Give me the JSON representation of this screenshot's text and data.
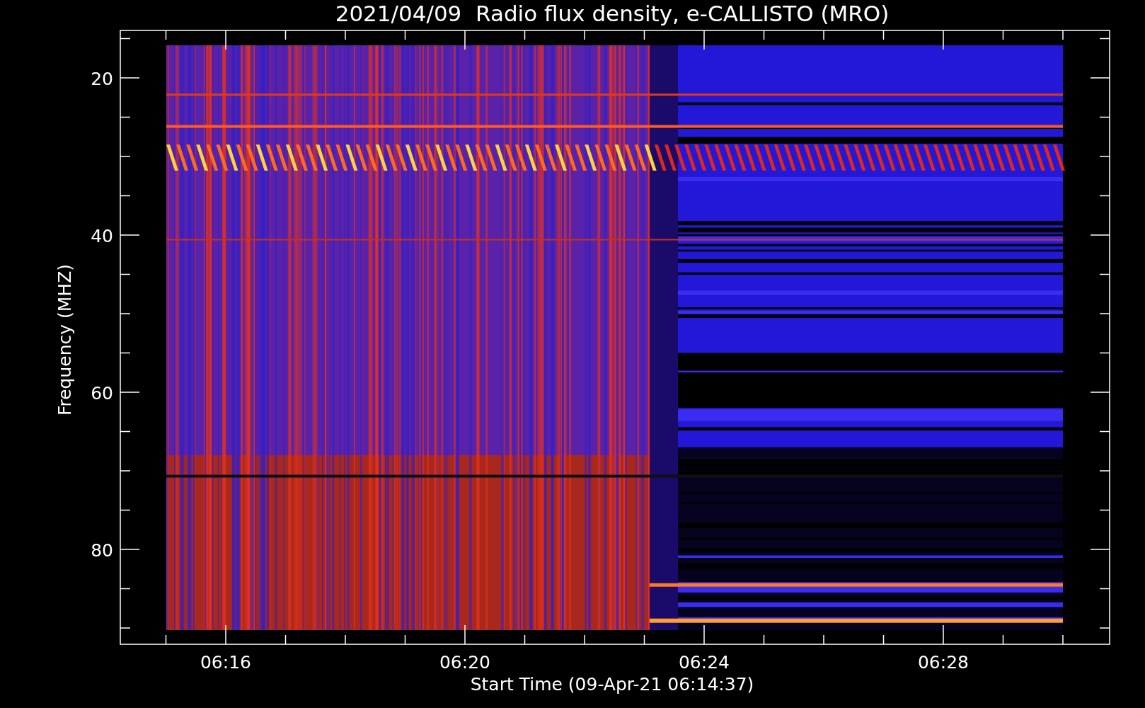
{
  "title": "2021/04/09  Radio flux density, e-CALLISTO (MRO)",
  "ylabel": "Frequency (MHZ)",
  "xlabel": "Start Time (09-Apr-21 06:14:37)",
  "y_tick_labels": [
    "20",
    "40",
    "60",
    "80"
  ],
  "x_tick_labels": [
    "06:16",
    "06:20",
    "06:24",
    "06:28"
  ]
}
